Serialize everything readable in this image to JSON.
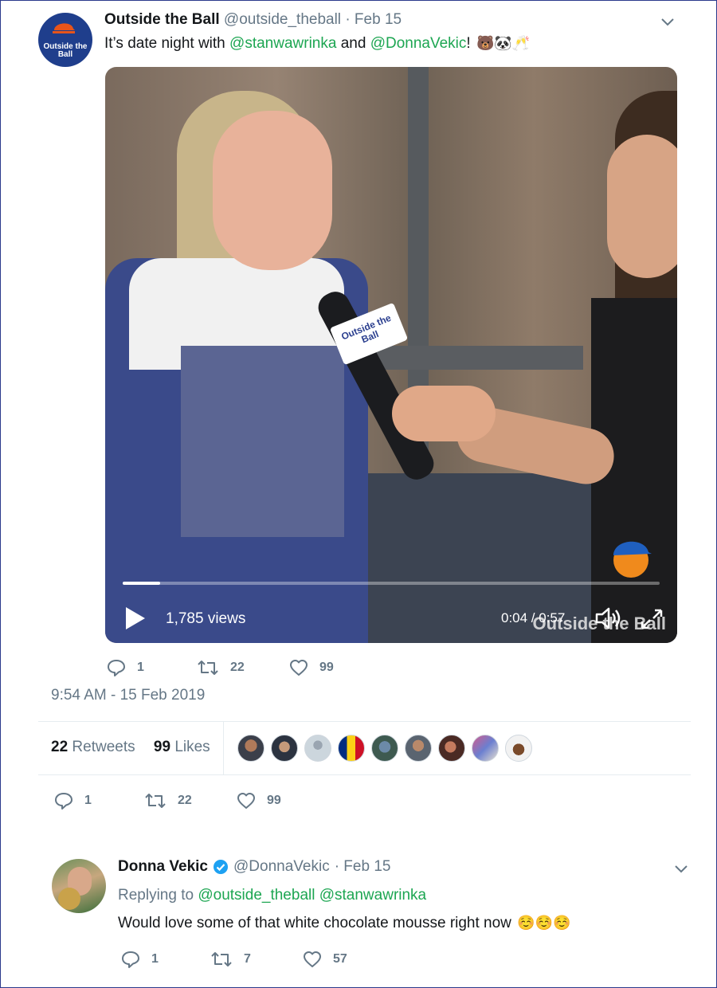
{
  "tweet": {
    "author_name": "Outside the Ball",
    "author_handle": "@outside_theball",
    "date": "· Feb 15",
    "avatar_text": "Outside the Ball",
    "text_prefix": "It’s date night with ",
    "mention_1": "@stanwawrinka",
    "text_middle": " and ",
    "mention_2": "@DonnaVekic",
    "text_suffix": "!",
    "emojis": "🐻🐼🥂",
    "video": {
      "views": "1,785 views",
      "time": "0:04 / 0:57",
      "progress_fraction": 0.07,
      "mic_flag_text": "Outside the Ball",
      "watermark_text": "Outside the Ball"
    },
    "actions": {
      "replies": "1",
      "retweets": "22",
      "likes": "99"
    },
    "timestamp": "9:54 AM - 15 Feb 2019",
    "stats": {
      "retweets_count": "22",
      "retweets_label": "Retweets",
      "likes_count": "99",
      "likes_label": "Likes"
    },
    "actions_bottom": {
      "replies": "1",
      "retweets": "22",
      "likes": "99"
    }
  },
  "reply": {
    "author_name": "Donna Vekic",
    "author_handle": "@DonnaVekic",
    "date": "· Feb 15",
    "replying_label": "Replying to ",
    "replying_mentions": "@outside_theball @stanwawrinka",
    "text": "Would love some of that white chocolate mousse right now",
    "emojis": "☺️☺️☺️",
    "actions": {
      "replies": "1",
      "retweets": "7",
      "likes": "57"
    }
  },
  "colors": {
    "link": "#1da652",
    "muted": "#657786",
    "brand_blue": "#1f3e8c",
    "verified": "#1da1f2"
  }
}
